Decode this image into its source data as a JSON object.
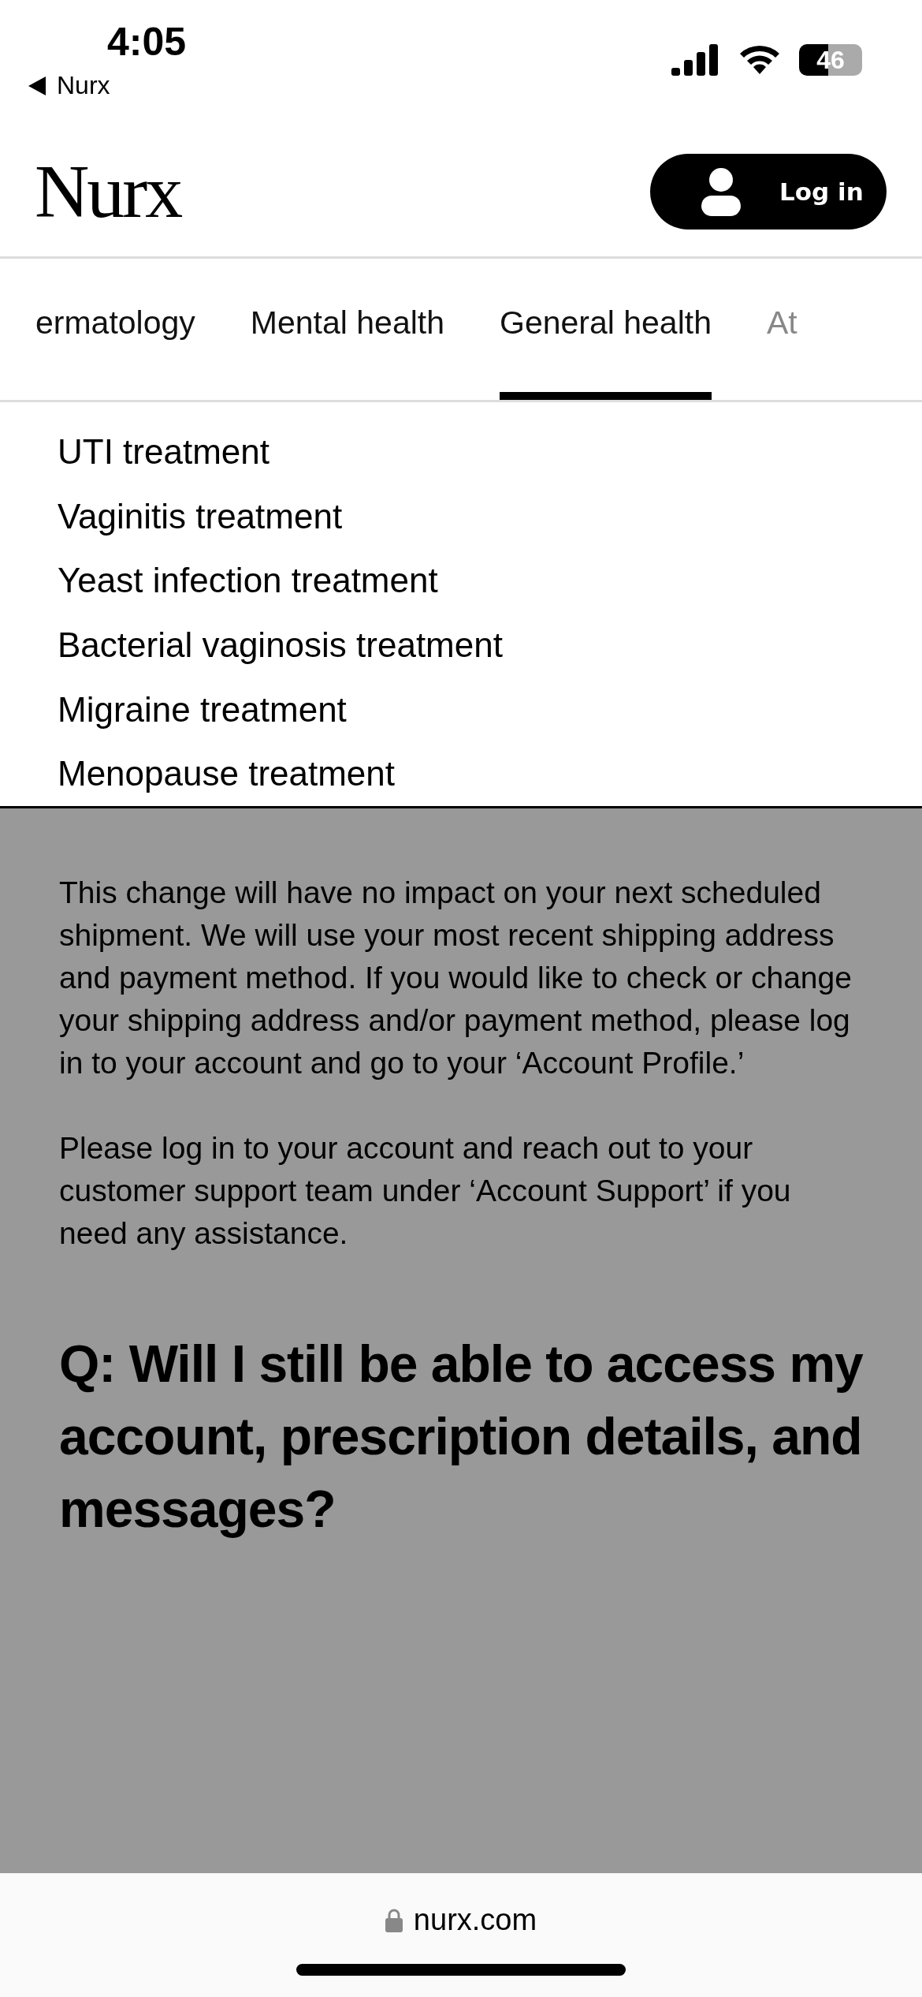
{
  "status_bar": {
    "time": "4:05",
    "back_label": "Nurx",
    "battery": "46"
  },
  "header": {
    "logo": "Nurx",
    "login_button": "Log in"
  },
  "tabs": [
    {
      "label": "ermatology",
      "selected": false,
      "faded": false
    },
    {
      "label": "Mental health",
      "selected": false,
      "faded": false
    },
    {
      "label": "General health",
      "selected": true,
      "faded": false
    },
    {
      "label": "At",
      "selected": false,
      "faded": true
    }
  ],
  "menu_items": [
    "UTI treatment",
    "Vaginitis treatment",
    "Yeast infection treatment",
    "Bacterial vaginosis treatment",
    "Migraine treatment",
    "Menopause treatment"
  ],
  "content": {
    "paragraphs": [
      "This change will have no impact on your next scheduled shipment. We will use your most recent shipping address and payment method. If you would like to check or change your shipping address and/or payment method, please log in to your account and go to your ‘Account Profile.’",
      "Please log in to your account and reach out to your customer support team under ‘Account Support’ if you need any assistance."
    ],
    "heading": "Q: Will I still be able to access my account, prescription details, and messages?"
  },
  "address_bar": {
    "url": "nurx.com"
  }
}
